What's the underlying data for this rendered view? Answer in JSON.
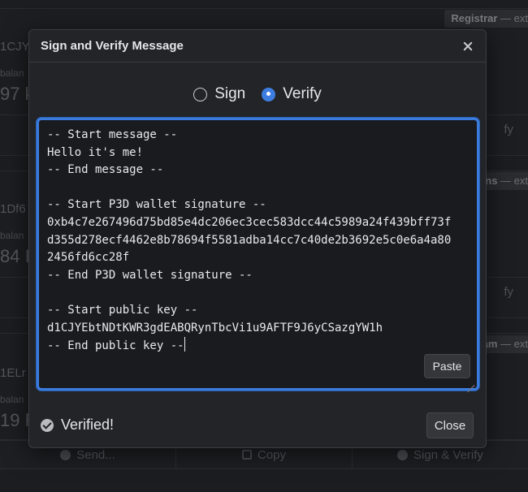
{
  "background": {
    "cards": [
      {
        "tag_bold": "Registrar",
        "tag_rest": " — ext",
        "address": "1CJY",
        "balance_label": "balan",
        "balance_value": "97 k",
        "side_button": "fy"
      },
      {
        "tag_bold": "ns",
        "tag_rest": " — ext",
        "address": "1Df6",
        "balance_label": "balan",
        "balance_value": "84 I",
        "side_button": "fy"
      },
      {
        "tag_bold": "am",
        "tag_rest": " — ext",
        "address": "1ELr",
        "balance_label": "balan",
        "balance_value": "19 F",
        "side_button": ""
      }
    ],
    "bottom_buttons": [
      "Send...",
      "Copy",
      "Sign & Verify"
    ]
  },
  "modal": {
    "title": "Sign and Verify Message",
    "mode_options": [
      {
        "label": "Sign",
        "selected": false
      },
      {
        "label": "Verify",
        "selected": true
      }
    ],
    "message_lines": [
      "-- Start message --",
      "Hello it's me!",
      "-- End message --",
      "",
      "-- Start P3D wallet signature --",
      "0xb4c7e267496d75bd85e4dc206ec3cec583dcc44c5989a24f439bff73f",
      "d355d278ecf4462e8b78694f5581adba14cc7c40de2b3692e5c0e6a4a80",
      "2456fd6cc28f",
      "-- End P3D wallet signature --",
      "",
      "-- Start public key --",
      "d1CJYEbtNDtKWR3gdEABQRynTbcVi1u9AFTF9J6yCSazgYW1h",
      "-- End public key --"
    ],
    "paste_label": "Paste",
    "status_text": "Verified!",
    "close_label": "Close",
    "accent_color": "#3a7bdd"
  }
}
